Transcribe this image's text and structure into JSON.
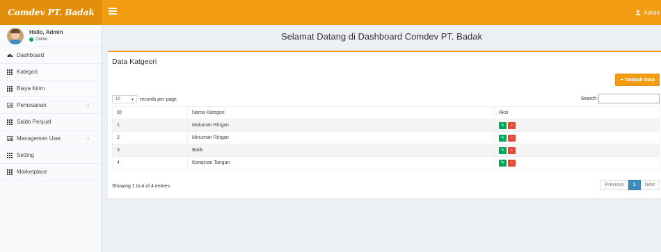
{
  "header": {
    "brand": "Comdev PT. Badak",
    "user_label": "Admin"
  },
  "sidebar": {
    "user_name": "Hallo, Admin",
    "user_status": "Online",
    "items": [
      {
        "label": "Dashboard",
        "icon": "dashboard-icon"
      },
      {
        "label": "Kategori",
        "icon": "table-icon"
      },
      {
        "label": "Biaya Kirim",
        "icon": "table-icon"
      },
      {
        "label": "Pemesanan",
        "icon": "chart-icon"
      },
      {
        "label": "Saldo Penjual",
        "icon": "table-icon"
      },
      {
        "label": "Managemen User",
        "icon": "chart-icon"
      },
      {
        "label": "Setting",
        "icon": "table-icon"
      },
      {
        "label": "Marketplace",
        "icon": "table-icon"
      }
    ],
    "chevron": "‹"
  },
  "main": {
    "welcome": "Selamat Datang di Dashboard Comdev PT. Badak",
    "box_title": "Data Katgeori",
    "add_button": "Tambah Data",
    "length_value": "10",
    "length_suffix": "records per page",
    "search_label": "Search:",
    "search_value": "",
    "table": {
      "headers": [
        "ID",
        "Nama Kategori",
        "Aksi"
      ],
      "rows": [
        {
          "id": "1",
          "name": "Makanan Ringan"
        },
        {
          "id": "2",
          "name": "Minuman Ringan"
        },
        {
          "id": "3",
          "name": "Batik"
        },
        {
          "id": "4",
          "name": "Kerajinan Tangan"
        }
      ]
    },
    "info": "Showing 1 to 4 of 4 entries",
    "pagination": {
      "previous": "Previous",
      "page": "1",
      "next": "Next"
    }
  },
  "colors": {
    "accent": "#f39c12",
    "brand_bg": "#e08e0b",
    "edit": "#00a65a",
    "delete": "#dd4b39",
    "active_page": "#3c8dbc"
  }
}
